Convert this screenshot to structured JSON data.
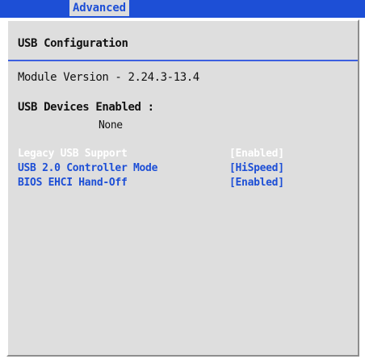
{
  "header": {
    "tab_label": "Advanced"
  },
  "panel": {
    "title": "USB Configuration",
    "module_version": "Module Version - 2.24.3-13.4",
    "devices_enabled_label": "USB Devices Enabled :",
    "devices_enabled_value": "None"
  },
  "options": [
    {
      "label": "Legacy USB Support",
      "value": "[Enabled]",
      "selected": true
    },
    {
      "label": "USB 2.0 Controller Mode",
      "value": "[HiSpeed]",
      "selected": false
    },
    {
      "label": "BIOS EHCI Hand-Off",
      "value": "[Enabled]",
      "selected": false
    }
  ],
  "colors": {
    "bar_blue": "#1d4fd6",
    "panel_gray": "#dedede",
    "highlight_text": "#ffffff",
    "option_text": "#1d4fd6"
  }
}
